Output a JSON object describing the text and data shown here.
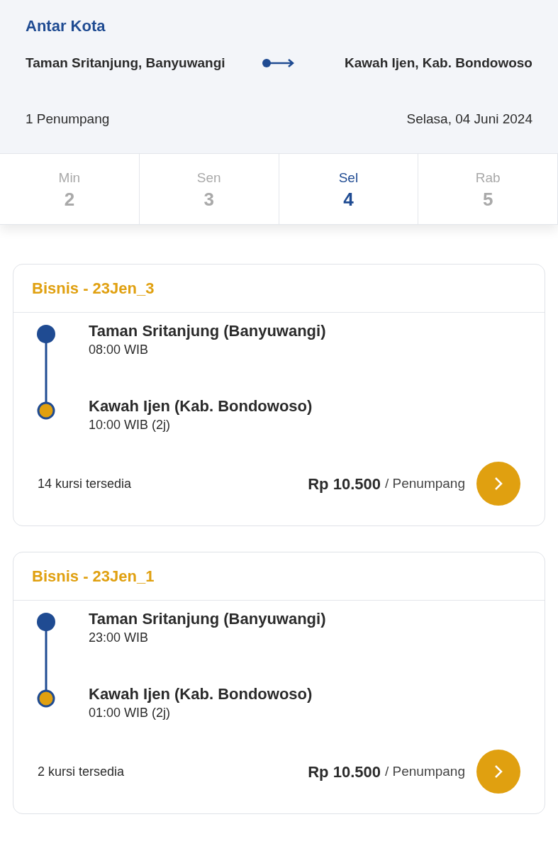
{
  "header": {
    "title": "Antar Kota",
    "origin": "Taman Sritanjung, Banyuwangi",
    "destination": "Kawah Ijen, Kab. Bondowoso",
    "passengers": "1 Penumpang",
    "date": "Selasa, 04 Juni 2024"
  },
  "days": [
    {
      "day": "Min",
      "date": "2",
      "selected": false
    },
    {
      "day": "Sen",
      "date": "3",
      "selected": false
    },
    {
      "day": "Sel",
      "date": "4",
      "selected": true
    },
    {
      "day": "Rab",
      "date": "5",
      "selected": false
    }
  ],
  "trips": [
    {
      "title": "Bisnis - 23Jen_3",
      "departure": {
        "place": "Taman Sritanjung (Banyuwangi)",
        "time": "08:00 WIB"
      },
      "arrival": {
        "place": "Kawah Ijen (Kab. Bondowoso)",
        "time": "10:00 WIB (2j)"
      },
      "seats": "14 kursi tersedia",
      "price": "Rp 10.500",
      "unit": "/ Penumpang"
    },
    {
      "title": "Bisnis - 23Jen_1",
      "departure": {
        "place": "Taman Sritanjung (Banyuwangi)",
        "time": "23:00 WIB"
      },
      "arrival": {
        "place": "Kawah Ijen (Kab. Bondowoso)",
        "time": "01:00 WIB (2j)"
      },
      "seats": "2 kursi tersedia",
      "price": "Rp 10.500",
      "unit": "/ Penumpang"
    }
  ]
}
